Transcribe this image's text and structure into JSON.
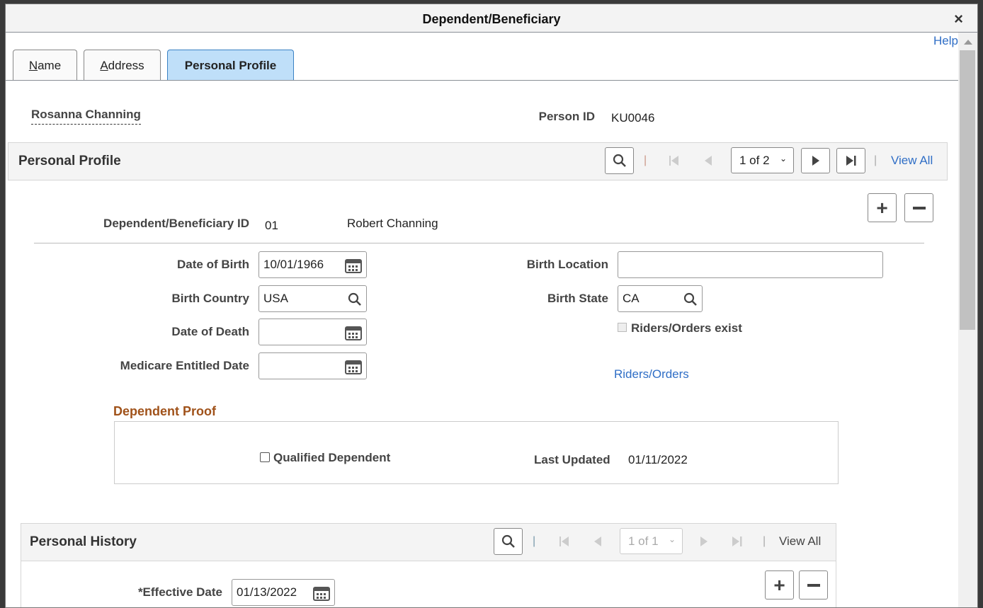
{
  "dialog": {
    "title": "Dependent/Beneficiary",
    "close_label": "×",
    "help": "Help"
  },
  "tabs": [
    {
      "label": "Name",
      "accel": "N",
      "rest": "ame"
    },
    {
      "label": "Address",
      "accel": "A",
      "rest": "ddress"
    },
    {
      "label": "Personal Profile"
    }
  ],
  "header": {
    "name": "Rosanna Channing",
    "person_id_label": "Person ID",
    "person_id": "KU0046"
  },
  "personal_profile": {
    "title": "Personal Profile",
    "pager": "1 of 2",
    "view_all": "View All",
    "dep_id_label": "Dependent/Beneficiary ID",
    "dep_id": "01",
    "dep_name": "Robert Channing",
    "dob_label": "Date of Birth",
    "dob": "10/01/1966",
    "birth_country_label": "Birth Country",
    "birth_country": "USA",
    "dod_label": "Date of Death",
    "dod": "",
    "medicare_label": "Medicare Entitled Date",
    "medicare": "",
    "birth_location_label": "Birth Location",
    "birth_location": "",
    "birth_state_label": "Birth State",
    "birth_state": "CA",
    "riders_exist_label": "Riders/Orders exist",
    "riders_link": "Riders/Orders",
    "proof_title": "Dependent Proof",
    "qualified_label": "Qualified Dependent",
    "last_updated_label": "Last Updated",
    "last_updated": "01/11/2022"
  },
  "personal_history": {
    "title": "Personal History",
    "pager": "1 of 1",
    "view_all": "View All",
    "eff_label": "*Effective Date",
    "eff_date": "01/13/2022"
  },
  "colors": {
    "accent": "#2f6ec6",
    "tab_active": "#bfdff9",
    "proof_title": "#a0521a"
  }
}
